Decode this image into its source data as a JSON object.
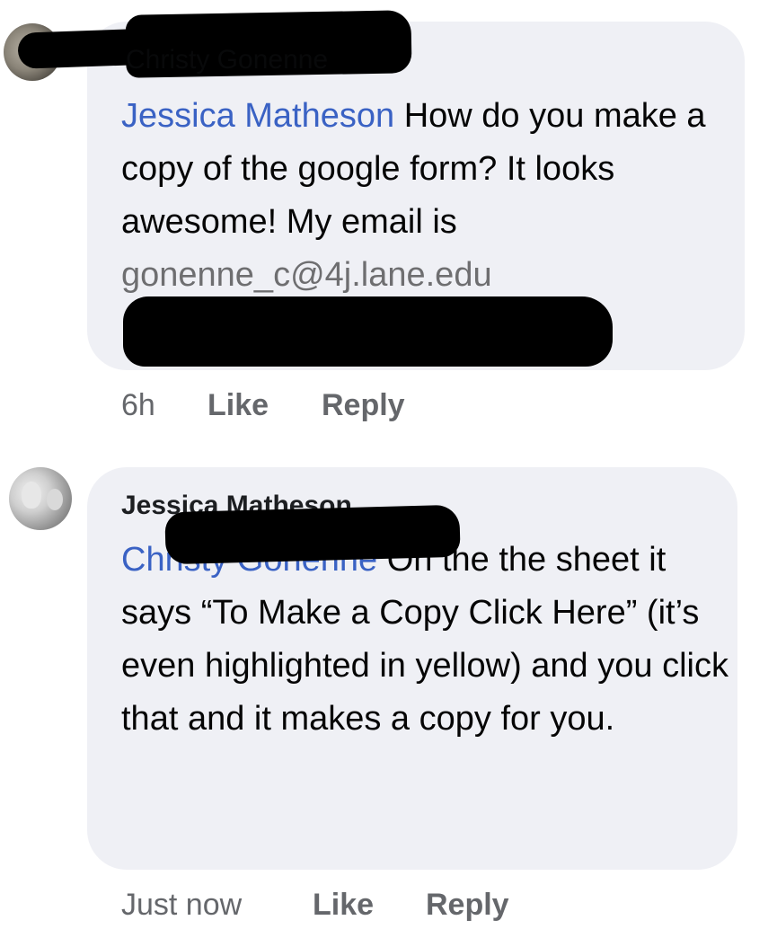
{
  "comments": [
    {
      "author": "Christy Gonenne",
      "mention": "Jessica Matheson",
      "text": " How do you make a copy of the google form?  It looks awesome! My email is",
      "email": "gonenne_c@4j.lane.edu",
      "time": "6h",
      "like_label": "Like",
      "reply_label": "Reply"
    },
    {
      "author": "Jessica Matheson",
      "mention": "Christy Gonenne",
      "text": " On the the sheet it says “To Make a Copy Click Here” (it’s even highlighted in yellow) and you click that and it makes a copy for you.",
      "time": "Just now",
      "like_label": "Like",
      "reply_label": "Reply"
    }
  ]
}
